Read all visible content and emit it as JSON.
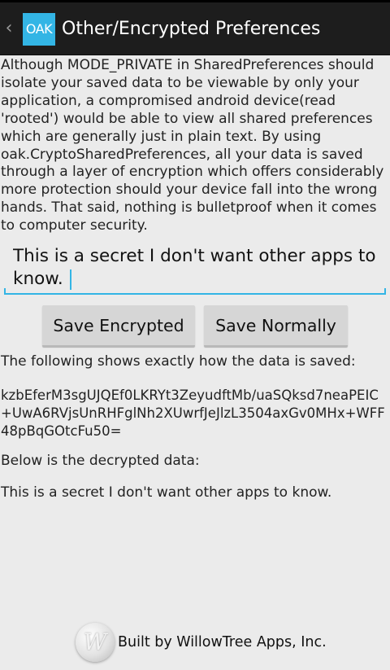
{
  "action_bar": {
    "app_icon_text": "OAK",
    "title": "Other/Encrypted Preferences",
    "up_icon": "chevron-left-icon",
    "app_icon_color": "#33b5e5",
    "background": "#1d1d1d"
  },
  "intro_text": "Although MODE_PRIVATE in SharedPreferences should isolate your saved data to be viewable by only your application, a compromised android device(read 'rooted') would be able to view all shared preferences which are generally just in plain text. By using oak.CryptoSharedPreferences, all your data is saved through a layer of encryption which offers considerably more protection should your device fall into the wrong hands. That said, nothing is bulletproof when it comes to computer security.",
  "secret_input": {
    "value": "This is a secret I don't want other apps to know.",
    "accent_color": "#33b5e5"
  },
  "buttons": {
    "save_encrypted": "Save Encrypted",
    "save_normally": "Save Normally"
  },
  "saved": {
    "label": "The following shows exactly how the data is saved:",
    "value": "kzbEferM3sgUJQEf0LKRYt3ZeyudftMb/uaSQksd7neaPEIC+UwA6RVjsUnRHFglNh2XUwrfJeJlzL3504axGv0MHx+WFF48pBqGOtcFu50="
  },
  "decrypted": {
    "label": "Below is the decrypted data:",
    "value": "This is a secret I don't want other apps to know."
  },
  "footer": {
    "logo_icon": "willowtree-logo-icon",
    "credit": "Built by WillowTree Apps, Inc."
  }
}
